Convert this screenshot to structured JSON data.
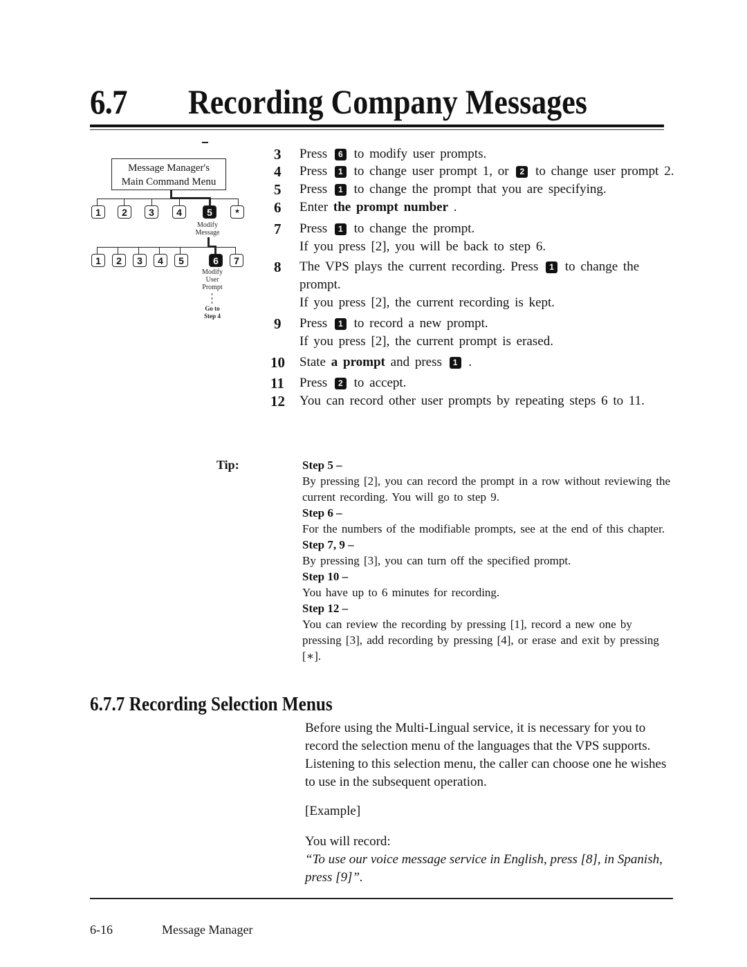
{
  "header": {
    "section_number": "6.7",
    "section_title": "Recording Company Messages"
  },
  "diagram": {
    "menu_box": [
      "Message Manager's",
      "Main Command Menu"
    ],
    "row1_keys": [
      "1",
      "2",
      "3",
      "4",
      "5",
      "*"
    ],
    "row1_selected": "5",
    "row1_label": [
      "Modify",
      "Message"
    ],
    "row2_keys": [
      "1",
      "2",
      "3",
      "4",
      "5",
      "6",
      "7"
    ],
    "row2_selected": "6",
    "row2_label": [
      "Modify",
      "User",
      "Prompt"
    ],
    "goto_label": [
      "Go to",
      "Step 4"
    ]
  },
  "steps": [
    {
      "num": "3",
      "parts": [
        "Press",
        "6",
        "to modify user prompts."
      ]
    },
    {
      "num": "4",
      "parts": [
        "Press",
        "1",
        "to change user prompt 1, or",
        "2",
        "to change user prompt 2."
      ]
    },
    {
      "num": "5",
      "parts": [
        "Press",
        "1",
        "to change the prompt that you are specifying."
      ]
    },
    {
      "num": "6",
      "parts": [
        "Enter",
        "the prompt number",
        "."
      ]
    },
    {
      "num": "7",
      "parts": [
        "Press",
        "1",
        "to change the prompt."
      ],
      "note": "If you press [2], you will be back to step 6."
    },
    {
      "num": "8",
      "parts": [
        "The VPS plays the current recording.  Press",
        "1",
        "to change the prompt."
      ],
      "note": "If you press [2], the current recording is kept."
    },
    {
      "num": "9",
      "parts": [
        "Press",
        "1",
        "to record a new prompt."
      ],
      "note": "If you press [2], the current prompt is erased."
    },
    {
      "num": "10",
      "parts": [
        "State",
        "a prompt",
        "and press",
        "1",
        "."
      ]
    },
    {
      "num": "11",
      "parts": [
        "Press",
        "2",
        "to accept."
      ]
    },
    {
      "num": "12",
      "parts": [
        "You can record other user prompts by repeating steps 6 to 11."
      ]
    }
  ],
  "tip": {
    "label": "Tip:",
    "items": [
      {
        "head": "Step 5 –",
        "body": "By pressing [2], you can record the prompt in a row without reviewing the current recording.  You will go to step 9."
      },
      {
        "head": "Step 6 –",
        "body": "For the numbers of the modifiable prompts, see at the end of this chapter."
      },
      {
        "head": "Step 7, 9 –",
        "body": "By pressing [3], you can turn off the specified prompt."
      },
      {
        "head": "Step 10 –",
        "body": "You have up to 6 minutes for recording."
      },
      {
        "head": "Step 12 –",
        "body": "You can review the recording by pressing [1], record a new one by pressing [3], add recording by pressing [4], or erase and exit by pressing [∗]."
      }
    ]
  },
  "subsection": {
    "heading": "6.7.7  Recording Selection Menus",
    "para1": "Before using the Multi-Lingual service, it is necessary for you to record the selection menu of the languages that the VPS supports.",
    "para2": "Listening to this selection menu, the caller can choose one he wishes to use in the subsequent operation.",
    "example_label": "[Example]",
    "you_will_record": "You will record:",
    "quote": "“To use our voice message service in English, press [8], in Spanish, press [9]”."
  },
  "footer": {
    "page_number": "6-16",
    "manual_title": "Message Manager"
  }
}
